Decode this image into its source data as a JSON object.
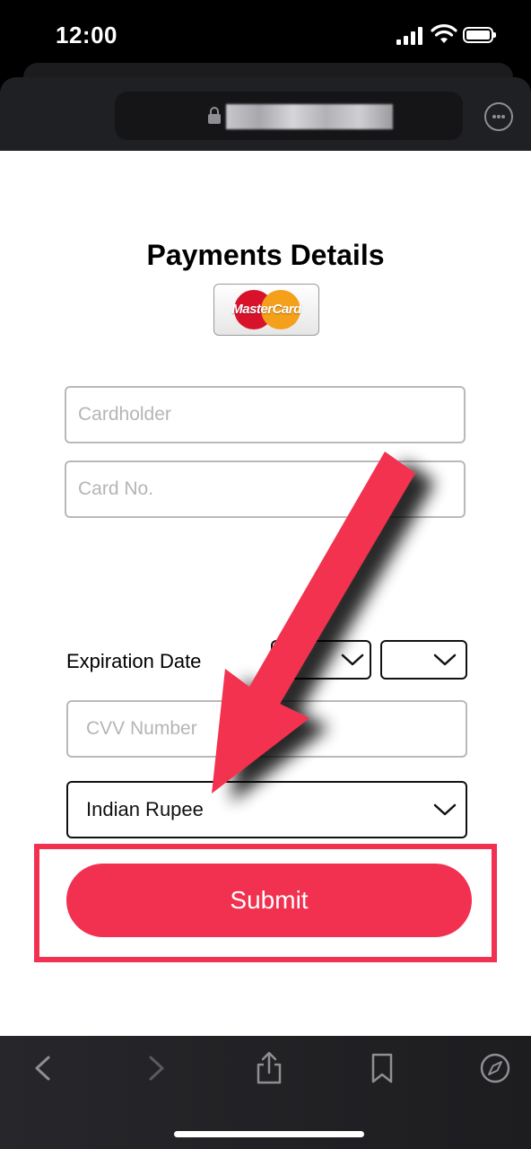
{
  "status_bar": {
    "time": "12:00",
    "icons": [
      "signal-icon",
      "wifi-icon",
      "battery-icon"
    ]
  },
  "browser": {
    "url_redacted": true,
    "lock_icon": "lock-icon",
    "more_icon": "more-icon"
  },
  "page": {
    "title": "Payments Details",
    "card_logo_text": "MasterCard",
    "cardholder_placeholder": "Cardholder",
    "card_number_placeholder": "Card No.",
    "expiration_label": "Expiration Date",
    "exp_month_value": "",
    "exp_year_value": "",
    "cvv_placeholder": "CVV Number",
    "currency_value": "Indian Rupee",
    "submit_label": "Submit"
  },
  "annotations": {
    "arrow_color": "#f2304f",
    "highlight_color": "#f2304f"
  },
  "toolbar": {
    "items": [
      "back-icon",
      "forward-icon",
      "share-icon",
      "bookmarks-icon",
      "compass-icon"
    ]
  },
  "colors": {
    "accent": "#f2304f",
    "topbar": "#000000",
    "toolbar": "#232326"
  }
}
